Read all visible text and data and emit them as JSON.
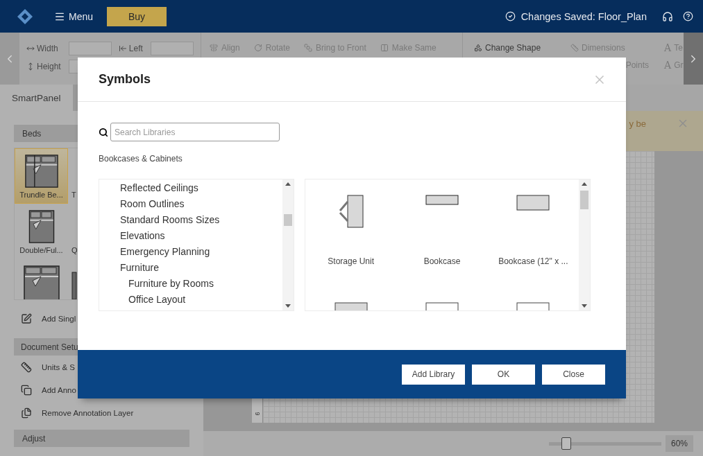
{
  "topbar": {
    "menu_label": "Menu",
    "buy_label": "Buy",
    "save_status": "Changes Saved: Floor_Plan"
  },
  "toolbar": {
    "size_fields": [
      {
        "label": "Width"
      },
      {
        "label": "Left"
      },
      {
        "label": "Height"
      }
    ],
    "actions": [
      "Align",
      "Rotate",
      "Bring to Front",
      "Make Same"
    ],
    "shape_tools": [
      {
        "kind": "icon",
        "label": "Change Shape"
      },
      {
        "kind": "icon",
        "label": "Dimensions"
      },
      {
        "kind": "glyph",
        "glyph": "A",
        "label": "Te"
      },
      {
        "kind": "plain",
        "label": "Points"
      },
      {
        "kind": "glyph",
        "glyph": "A",
        "label": "Gr"
      }
    ]
  },
  "smart_panel": {
    "tab": "SmartPanel",
    "beds": {
      "title": "Beds",
      "items": [
        {
          "kind": "trundle",
          "label": "Trundle Be...",
          "selected": true
        },
        {
          "kind": "none",
          "label": "T",
          "selected": false
        },
        {
          "kind": "double",
          "label": "Double/Ful...",
          "selected": false
        },
        {
          "kind": "none",
          "label": "Q",
          "selected": false
        },
        {
          "kind": "king",
          "selected": false
        },
        {
          "kind": "edge",
          "selected": false
        }
      ],
      "action": "Add Singl"
    },
    "document": {
      "title": "Document Setu",
      "items": [
        "Units & S",
        "Add Anno",
        "Remove Annotation Layer"
      ]
    },
    "adjust": {
      "title": "Adjust"
    }
  },
  "notification": {
    "text": "y be"
  },
  "canvas": {
    "ruler_label": "9"
  },
  "zoom": {
    "level": 0.12,
    "reading": "60%"
  },
  "dialog": {
    "title": "Symbols",
    "search": {
      "placeholder": "Search Libraries"
    },
    "current_library": "Bookcases & Cabinets",
    "libraries": [
      {
        "label": "Reflected Ceilings"
      },
      {
        "label": "Room Outlines"
      },
      {
        "label": "Standard Rooms Sizes"
      },
      {
        "label": "Elevations"
      },
      {
        "label": "Emergency Planning"
      },
      {
        "label": "Furniture",
        "children": [
          {
            "label": "Furniture by Rooms"
          },
          {
            "label": "Office Layout"
          }
        ]
      }
    ],
    "symbols": [
      {
        "kind": "storage",
        "label": "Storage Unit"
      },
      {
        "kind": "bookcase",
        "label": "Bookcase"
      },
      {
        "kind": "bookcase-wide",
        "label": "Bookcase (12\" x ..."
      },
      {
        "kind": "filled-box"
      },
      {
        "kind": "outline-box"
      },
      {
        "kind": "outline-box"
      }
    ],
    "buttons": [
      "Add Library",
      "OK",
      "Close"
    ]
  }
}
